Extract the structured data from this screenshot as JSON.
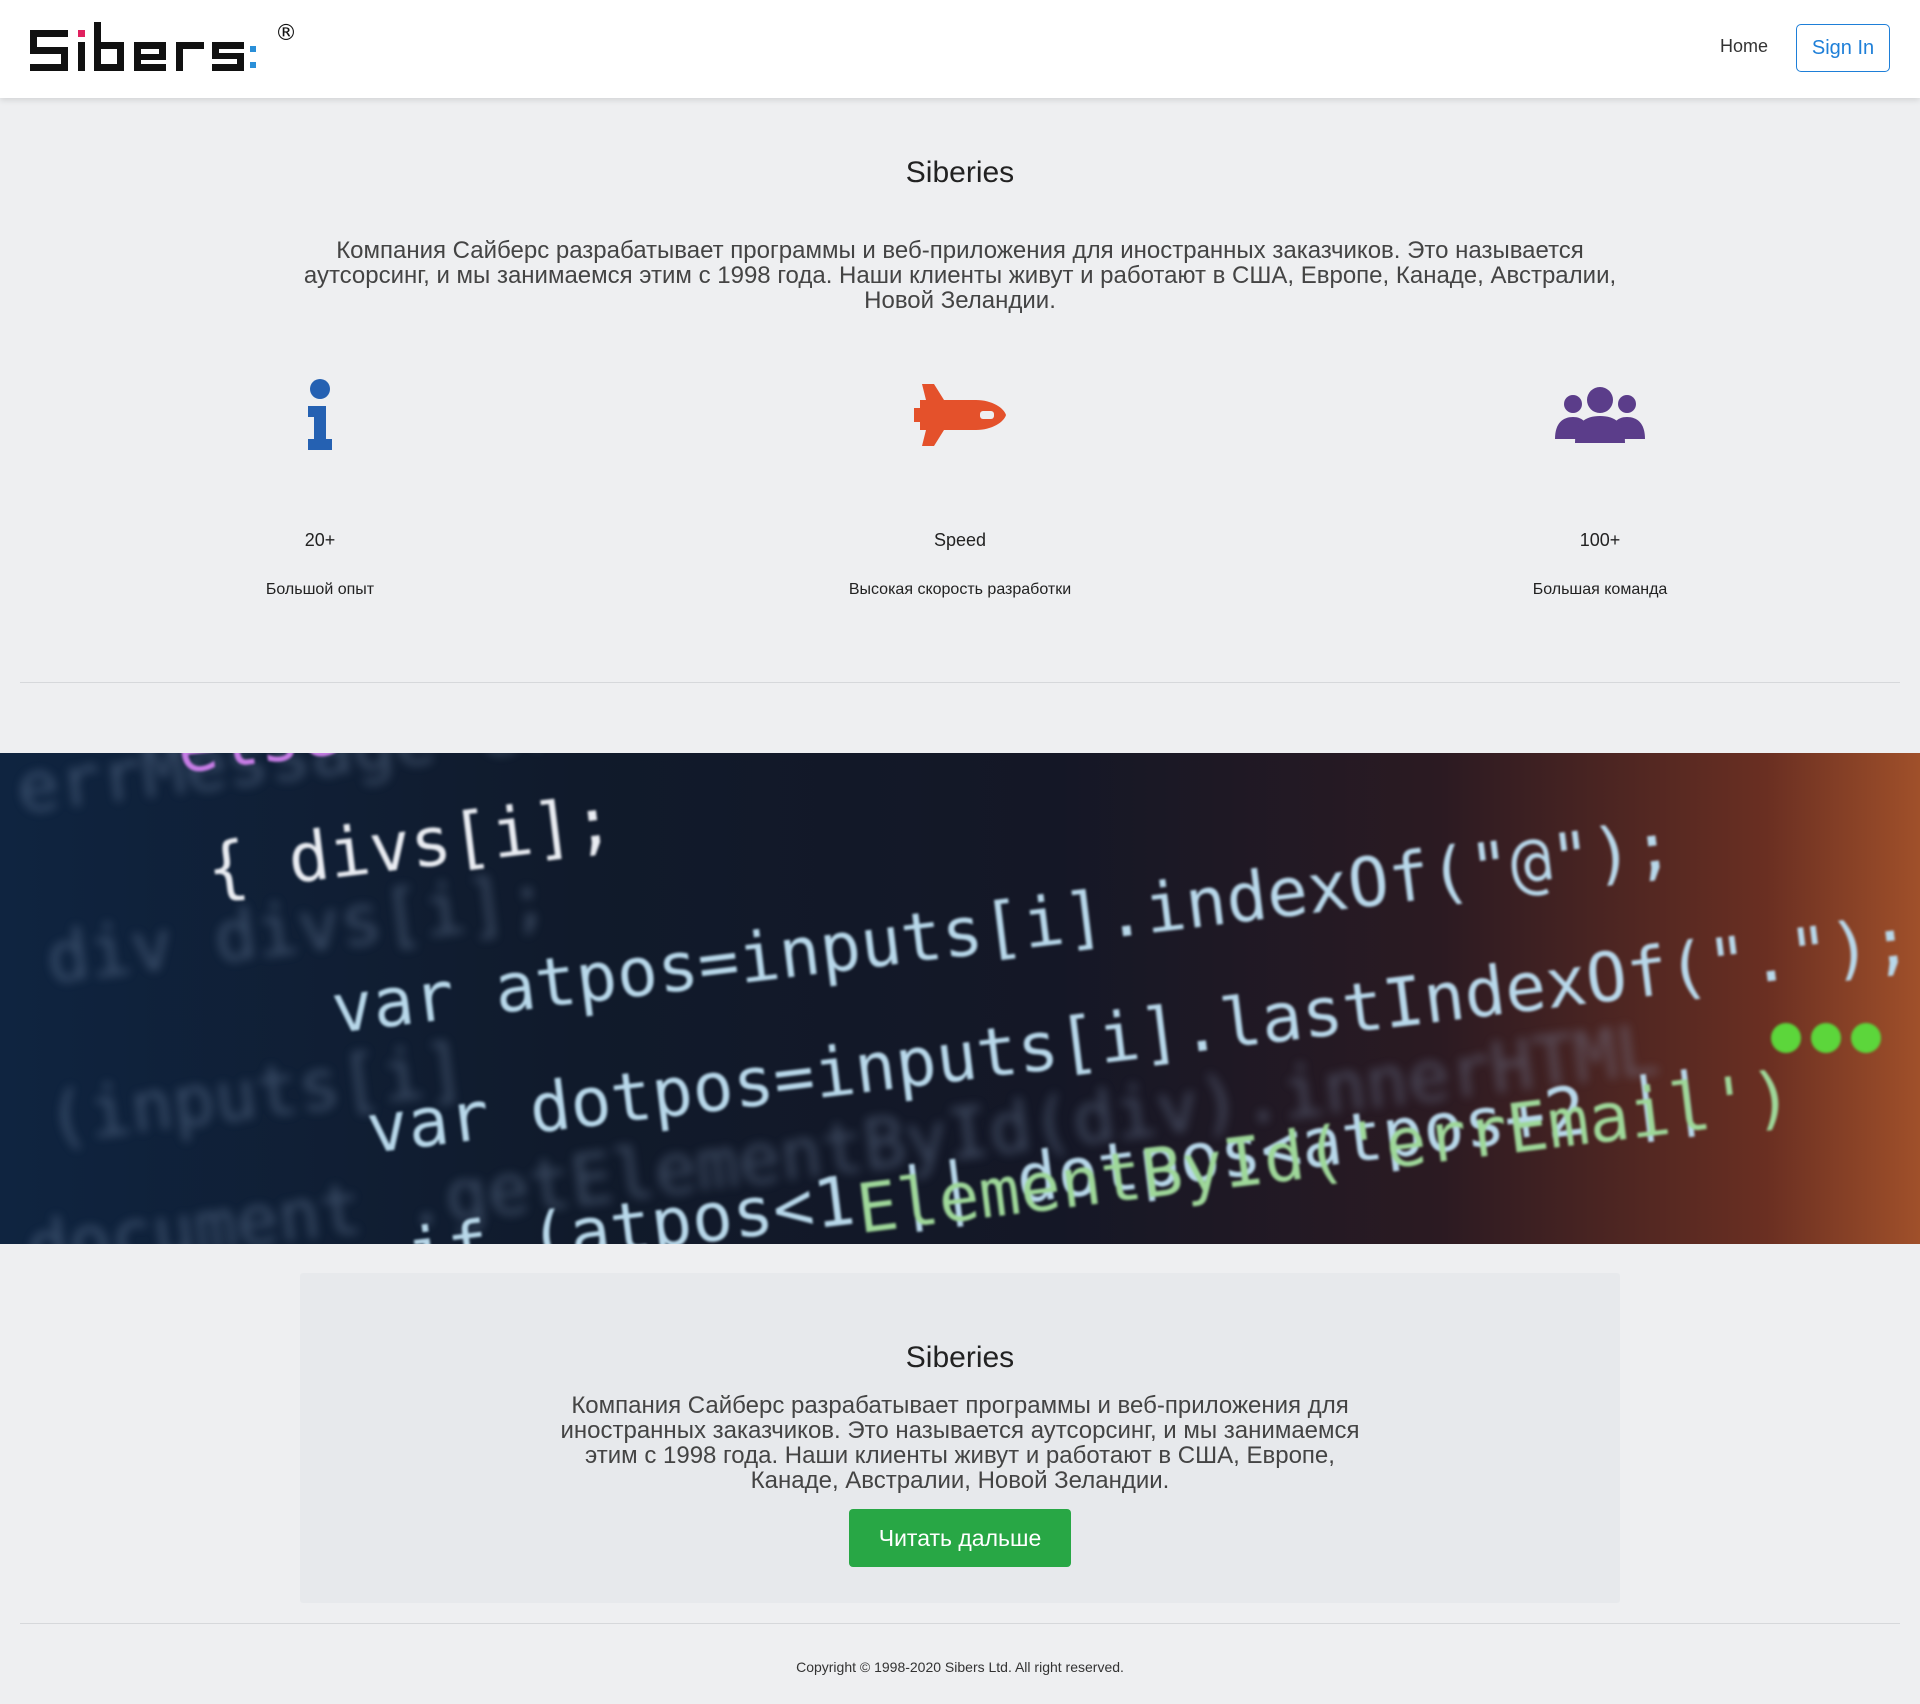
{
  "header": {
    "logo_text": "Sibers",
    "logo_mark": "®",
    "nav_home": "Home",
    "sign_in": "Sign In"
  },
  "hero": {
    "title": "Siberies",
    "text": "Компания Сайберс разрабатывает программы и веб-приложения для иностранных заказчиков. Это называется аутсорсинг, и мы занимаемся этим с 1998 года. Наши клиенты живут и работают в США, Европе, Канаде, Австралии, Новой Зеландии."
  },
  "features": [
    {
      "icon": "info-icon",
      "color": "#2561b2",
      "number": "20+",
      "label": "Большой опыт"
    },
    {
      "icon": "space-shuttle-icon",
      "color": "#e4512b",
      "number": "Speed",
      "label": "Высокая скорость разработки"
    },
    {
      "icon": "users-icon",
      "color": "#5b3d8a",
      "number": "100+",
      "label": "Большая команда"
    }
  ],
  "banner": {
    "code_lines": [
      "else if (errors[i])",
      "{   divs[i];",
      "var atpos=inputs[i].indexOf(\"@\");",
      "var dotpos=inputs[i].lastIndexOf(\".\");",
      "if (atpos<1 || dotpos<atpos+2 ||",
      "ElementById('errEmail')"
    ]
  },
  "card": {
    "title": "Siberies",
    "text": "Компания Сайберс разрабатывает программы и веб-приложения для иностранных заказчиков. Это называется аутсорсинг, и мы занимаемся этим с 1998 года. Наши клиенты живут и работают в США, Европе, Канаде, Австралии, Новой Зеландии.",
    "button": "Читать дальше"
  },
  "footer": {
    "copyright": "Copyright © 1998-2020 Sibers Ltd. All right reserved."
  },
  "colors": {
    "accent_blue": "#1e7fd8",
    "button_green": "#28a745"
  }
}
